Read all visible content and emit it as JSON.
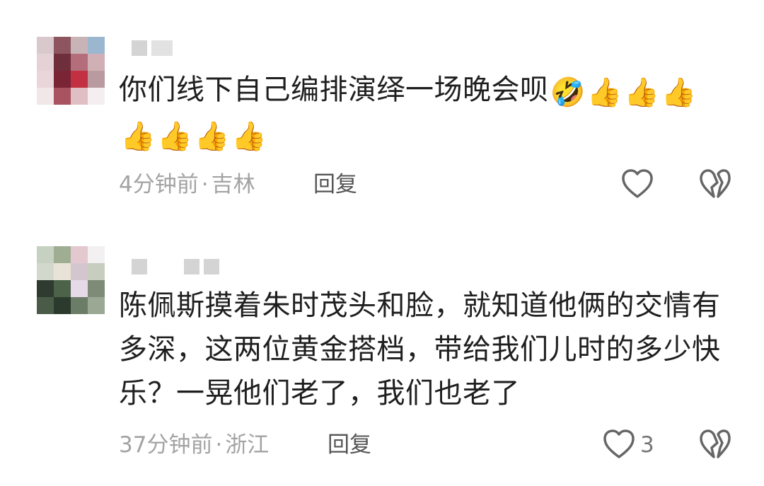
{
  "comments": [
    {
      "text": "你们线下自己编排演绎一场晚会呗",
      "emojis": [
        "🤣",
        "👍",
        "👍",
        "👍",
        "👍",
        "👍",
        "👍",
        "👍"
      ],
      "time": "4分钟前",
      "location": "吉林",
      "reply_label": "回复",
      "like_count": "",
      "avatar_colors": [
        "#d9c9cc",
        "#8c5560",
        "#c8b3b6",
        "#9bb7cf",
        "#e5d2d6",
        "#6e2e3c",
        "#b46d7a",
        "#d0b0b5",
        "#e8d6da",
        "#7a2536",
        "#c23041",
        "#b89aa0",
        "#f1e6e8",
        "#a8535f",
        "#e0bfc4",
        "#f5eef0"
      ]
    },
    {
      "text": "陈佩斯摸着朱时茂头和脸，就知道他俩的交情有多深，这两位黄金搭档，带给我们儿时的多少快乐？一晃他们老了，我们也老了",
      "emojis": [],
      "time": "37分钟前",
      "location": "浙江",
      "reply_label": "回复",
      "like_count": "3",
      "avatar_colors": [
        "#c7d1c2",
        "#9fae93",
        "#e3c9cf",
        "#f2f0f1",
        "#d2d8cc",
        "#e8e3d6",
        "#d4c6cf",
        "#c7cdbf",
        "#2f3b31",
        "#4c6249",
        "#e6d9e8",
        "#7d8b77",
        "#4a5b47",
        "#2c3a2d",
        "#6b7d67",
        "#9aa894"
      ]
    }
  ],
  "separator": "·"
}
